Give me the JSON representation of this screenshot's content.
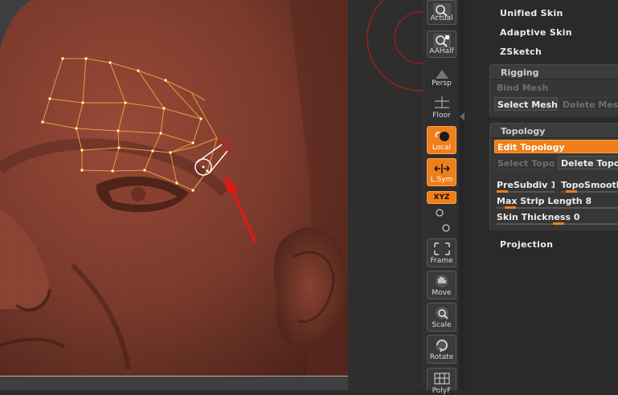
{
  "shelf": {
    "buttons": [
      {
        "label": "Actual",
        "icon": "magnifier-actual-icon"
      },
      {
        "label": "AAHalf",
        "icon": "magnifier-aahalf-icon"
      },
      {
        "label": "Persp",
        "icon": "perspective-icon"
      },
      {
        "label": "Floor",
        "icon": "floor-grid-icon"
      },
      {
        "label": "Local",
        "icon": "local-transform-icon",
        "active": true
      },
      {
        "label": "L.Sym",
        "icon": "local-symmetry-icon",
        "active": true
      },
      {
        "label": "XYZ",
        "icon": "xyz-axis-icon",
        "active": true
      },
      {
        "label": "Frame",
        "icon": "frame-icon"
      },
      {
        "label": "Move",
        "icon": "move-hand-icon"
      },
      {
        "label": "Scale",
        "icon": "scale-icon"
      },
      {
        "label": "Rotate",
        "icon": "rotate-icon"
      },
      {
        "label": "PolyF",
        "icon": "polyframe-icon"
      }
    ]
  },
  "palette": {
    "items_top": [
      "Unified Skin",
      "Adaptive Skin",
      "ZSketch"
    ],
    "rigging": {
      "title": "Rigging",
      "bind_mesh": "Bind Mesh",
      "select_mesh": "Select Mesh",
      "delete_mesh": "Delete Mesh"
    },
    "topology": {
      "title": "Topology",
      "edit_topology": "Edit Topology",
      "select_topo": "Select Topo",
      "delete_topo": "Delete Topo",
      "presubdiv": "PreSubdiv 1",
      "toposmooth": "TopoSmooth",
      "max_strip_length": "Max Strip Length 8",
      "skin_thickness": "Skin Thickness 0"
    },
    "projection": "Projection"
  },
  "colors": {
    "accent": "#ef7f1a",
    "skin": "#7a3a2c",
    "topology_lines": "#f0a040",
    "arrow": "#e01818"
  }
}
